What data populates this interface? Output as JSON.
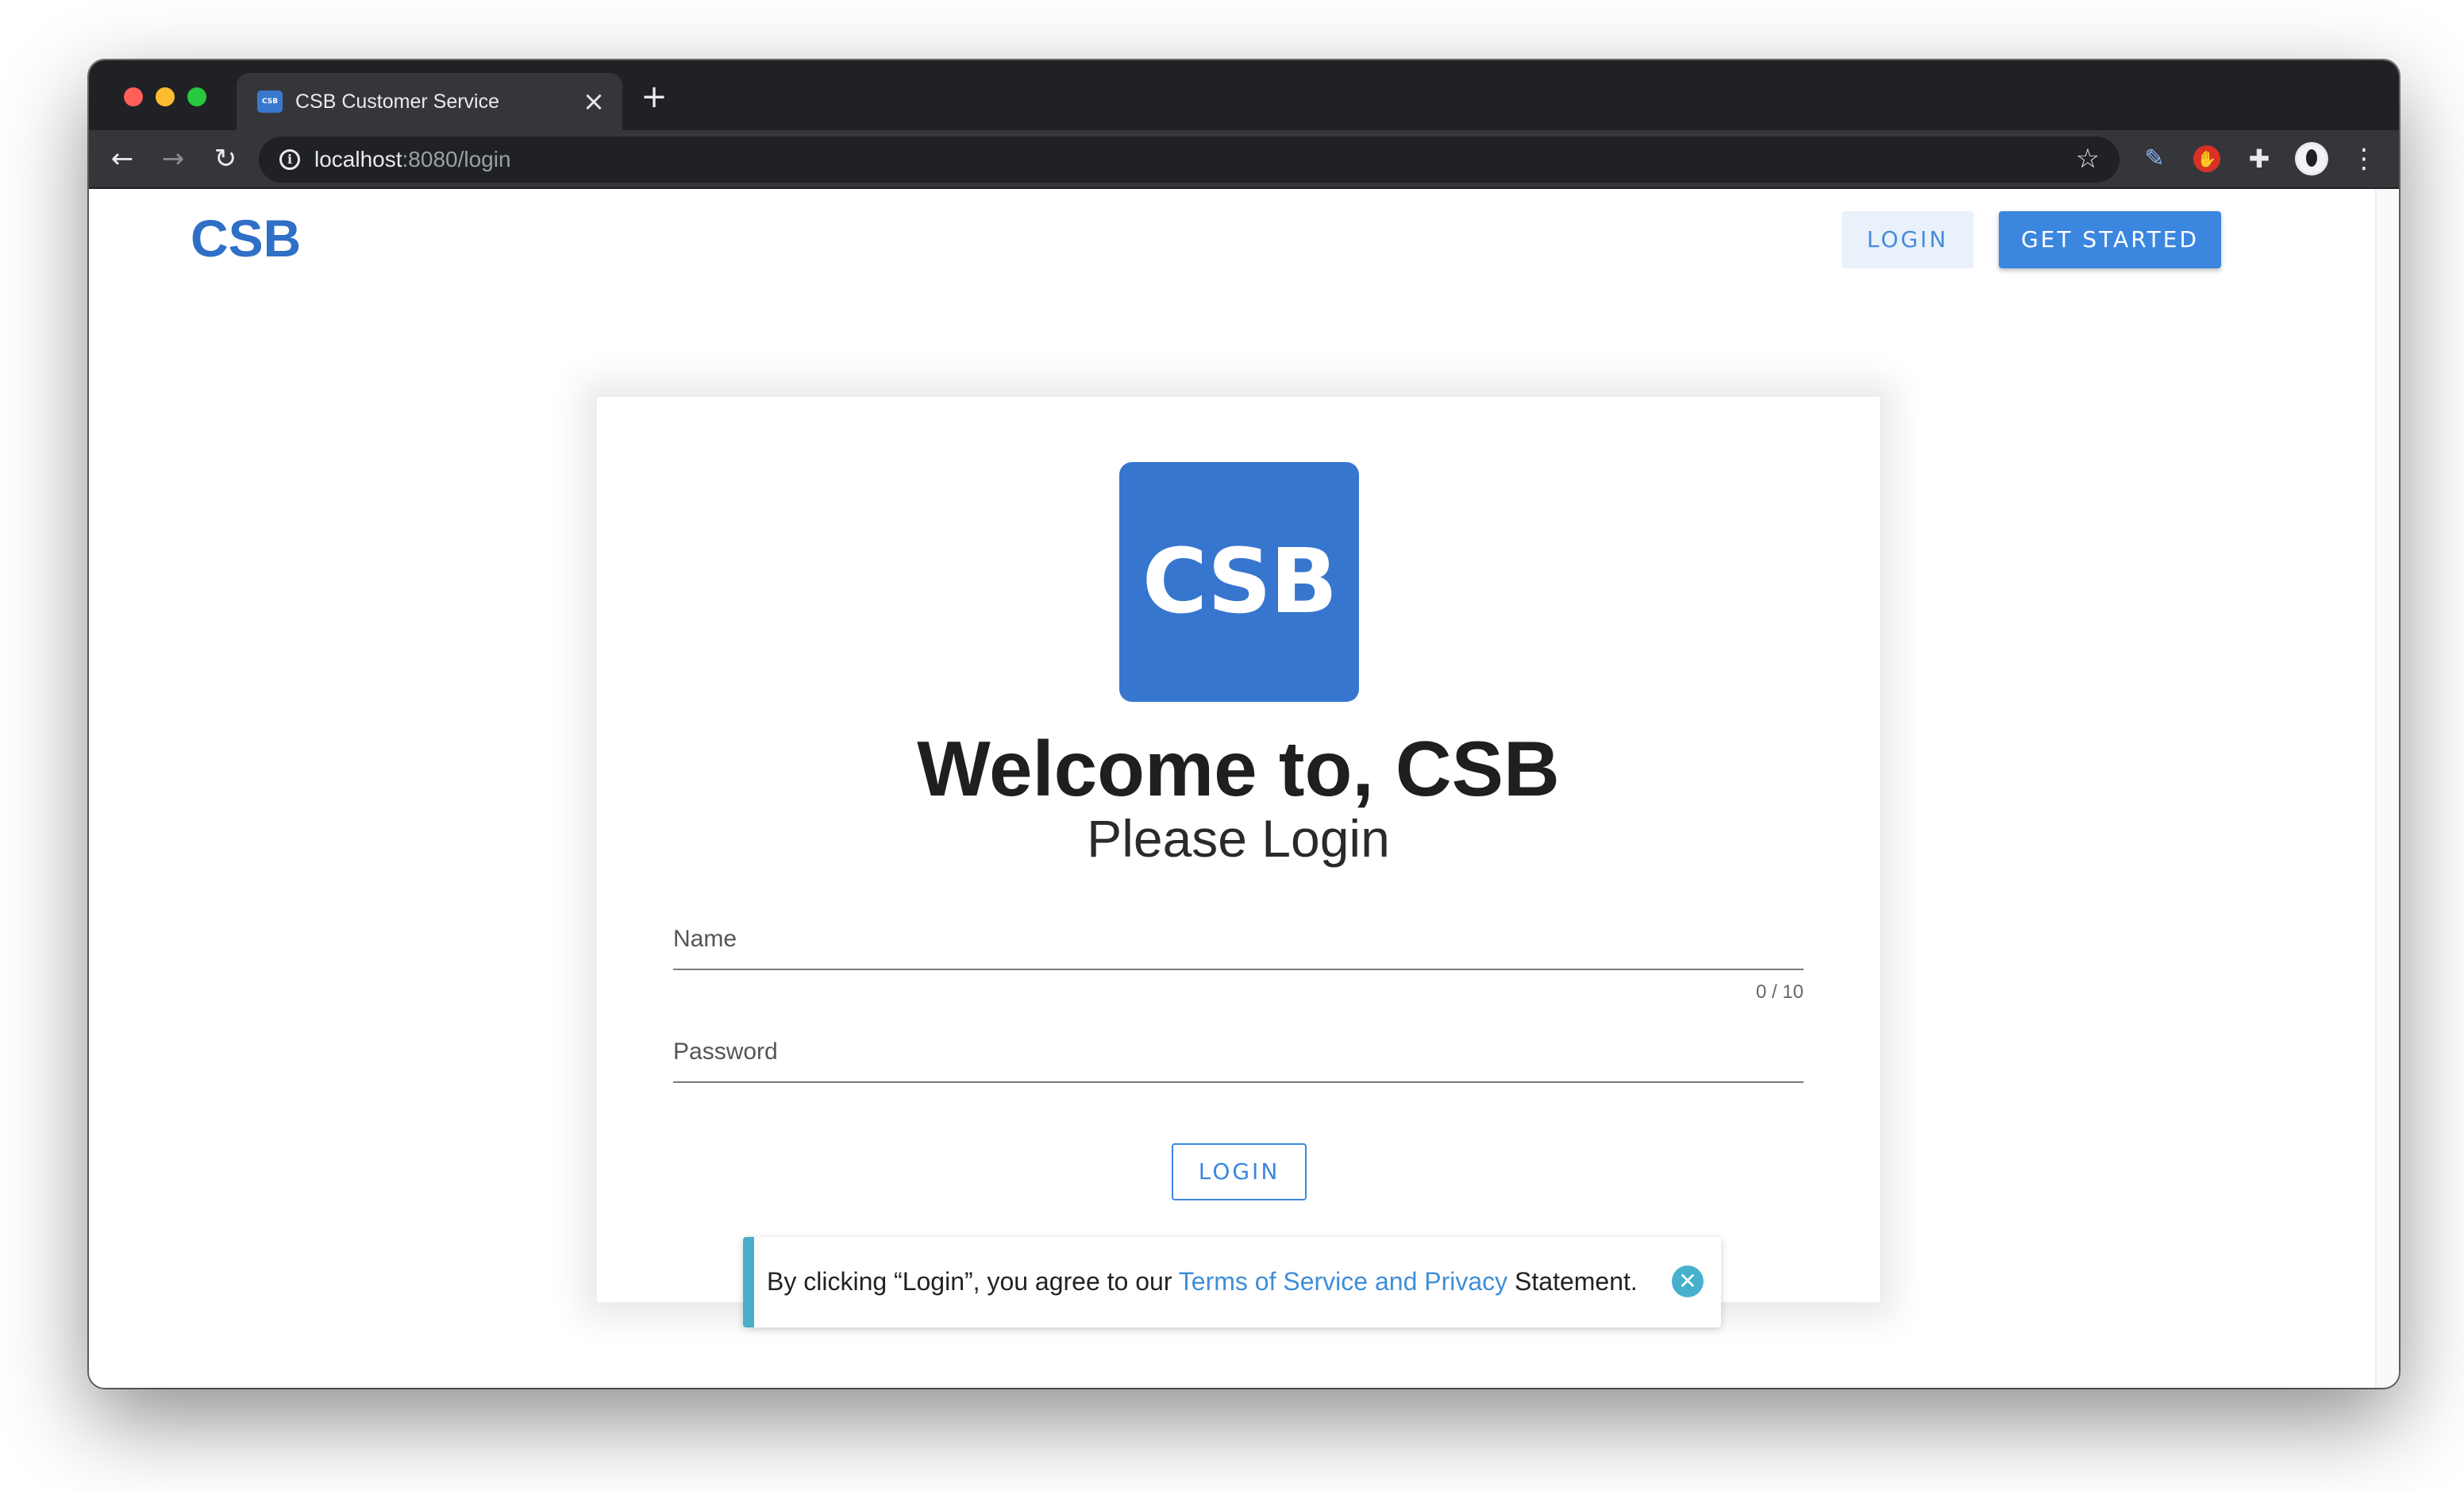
{
  "browser": {
    "tab_title": "CSB Customer Service",
    "tab_favicon_text": "CSB",
    "tab_close_glyph": "×",
    "new_tab_glyph": "+",
    "url_host": "localhost",
    "url_path": ":8080/login",
    "icons": {
      "back": "back-arrow-icon",
      "forward": "forward-arrow-icon",
      "reload": "reload-icon",
      "info": "info-icon",
      "bookmark": "star-icon",
      "extension_pen": "pen-icon",
      "extension_block": "stop-hand-icon",
      "extensions": "puzzle-icon",
      "profile": "avatar",
      "menu": "kebab-menu-icon"
    }
  },
  "header": {
    "brand": "CSB",
    "login_label": "LOGIN",
    "get_started_label": "GET STARTED"
  },
  "card": {
    "logo_text": "CSB",
    "title": "Welcome to, CSB",
    "subtitle": "Please Login",
    "name_label": "Name",
    "name_value": "",
    "name_counter": "0 / 10",
    "password_label": "Password",
    "password_value": "",
    "login_label": "LOGIN"
  },
  "toast": {
    "text_before": "By clicking “Login”, you agree to our ",
    "link": "Terms of Service and Privacy",
    "text_after": " Statement."
  },
  "colors": {
    "brand_blue": "#3676cf",
    "primary_button": "#3b86df",
    "toast_accent": "#4aaec8",
    "chrome_dark": "#202124"
  }
}
